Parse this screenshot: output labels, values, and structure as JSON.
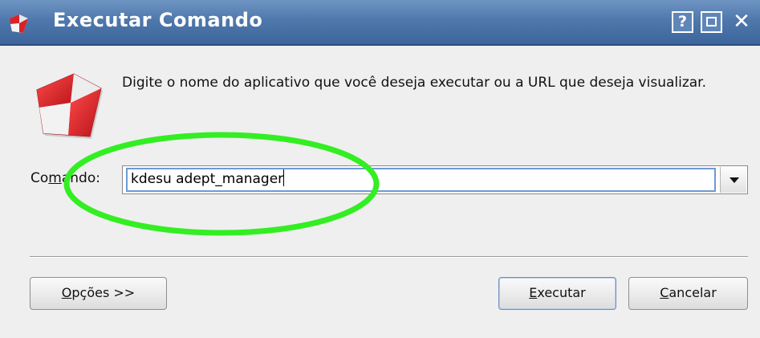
{
  "window": {
    "title": "Executar Comando",
    "help_button": "?",
    "close_button": "✕"
  },
  "main": {
    "description": "Digite o nome do aplicativo que você deseja executar ou a URL que deseja visualizar.",
    "command_label_prefix": "Co",
    "command_label_mnemonic": "m",
    "command_label_suffix": "ando:",
    "command_value": "kdesu adept_manager"
  },
  "buttons": {
    "options_mnemonic": "O",
    "options_rest": "pções >>",
    "execute_mnemonic": "E",
    "execute_rest": "xecutar",
    "cancel_mnemonic": "C",
    "cancel_rest": "ancelar"
  },
  "colors": {
    "titlebar": "#4f78ac",
    "highlight_ellipse": "#33ee22",
    "icon_red": "#d8232a",
    "input_focus": "#6d9ad6"
  },
  "icons": {
    "app": "kde-run-checkered-icon",
    "dropdown": "chevron-down-icon",
    "maximize": "maximize-icon"
  }
}
